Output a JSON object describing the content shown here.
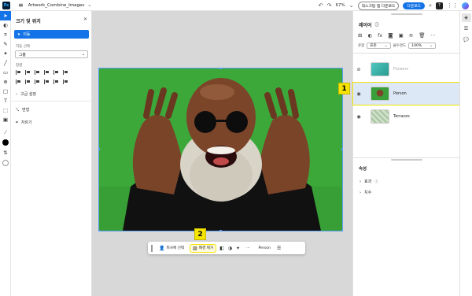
{
  "app": {
    "logo": "Ps",
    "filename": "Artwork_Combine_Images"
  },
  "topbar": {
    "zoom": "67%",
    "desktop_button": "데스크탑 앱 다운로드",
    "download_button": "다운로드",
    "help_label": "?"
  },
  "left_panel": {
    "title": "크기 및 위치",
    "move_button": "이동",
    "auto_select_label": "자동 선택",
    "auto_select_value": "그룹",
    "align_label": "정렬",
    "advanced": "고급 설정",
    "transform": "변형",
    "crop": "자르기"
  },
  "taskbar": {
    "select_subject": "피사체 선택",
    "remove_background": "배경 제거",
    "more": "···",
    "layer_name": "Person"
  },
  "callouts": {
    "one": "1",
    "two": "2"
  },
  "layers_panel": {
    "title": "레이어",
    "blend_label": "혼합",
    "blend_value": "표준",
    "opacity_label": "불투명도",
    "opacity_value": "100%",
    "layers": [
      {
        "name": "Flowers",
        "visible": false,
        "selected": false
      },
      {
        "name": "Person",
        "visible": true,
        "selected": true
      },
      {
        "name": "Terrazzo",
        "visible": true,
        "selected": false
      }
    ]
  },
  "properties_panel": {
    "title": "속성",
    "effects": "효과",
    "dimensions": "치수"
  },
  "colors": {
    "accent": "#1473e6",
    "highlight": "#f5e400",
    "canvas_green": "#3aa13a"
  }
}
